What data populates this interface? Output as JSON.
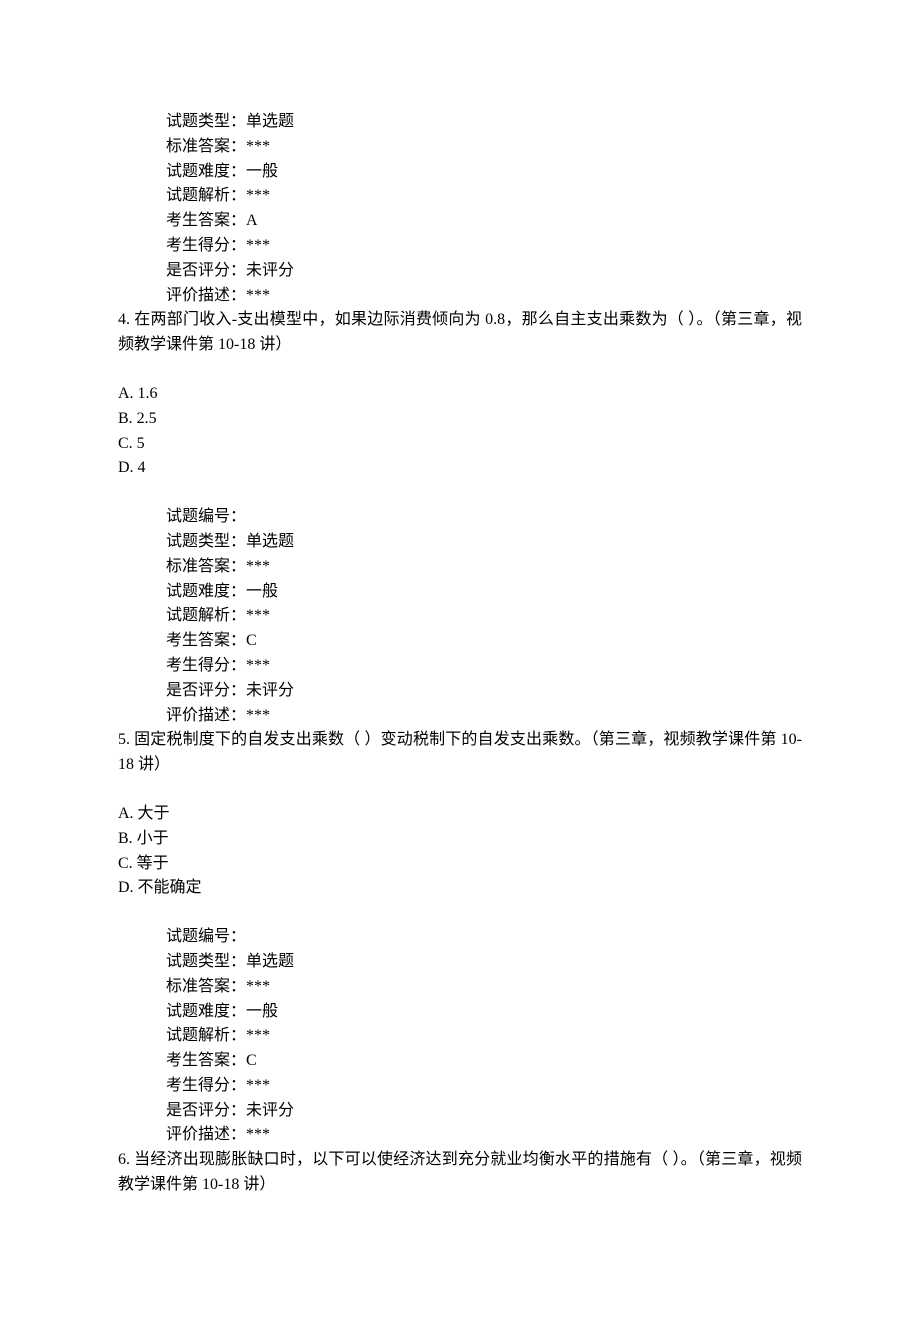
{
  "q3_meta": {
    "type_label": "试题类型：",
    "type_value": "单选题",
    "answer_key_label": "标准答案：",
    "answer_key_value": "***",
    "difficulty_label": "试题难度：",
    "difficulty_value": "一般",
    "analysis_label": "试题解析：",
    "analysis_value": "***",
    "student_answer_label": "考生答案：",
    "student_answer_value": "A",
    "student_score_label": "考生得分：",
    "student_score_value": "***",
    "graded_label": "是否评分：",
    "graded_value": "未评分",
    "desc_label": "评价描述：",
    "desc_value": "***"
  },
  "q4": {
    "number": "4.",
    "text": "    在两部门收入-支出模型中，如果边际消费倾向为 0.8，那么自主支出乘数为（  ）。（第三章，视频教学课件第 10-18 讲）",
    "options": {
      "a": "A. 1.6",
      "b": "B. 2.5",
      "c": "C. 5",
      "d": "D. 4"
    },
    "meta": {
      "id_label": "试题编号：",
      "id_value": "",
      "type_label": "试题类型：",
      "type_value": "单选题",
      "answer_key_label": "标准答案：",
      "answer_key_value": "***",
      "difficulty_label": "试题难度：",
      "difficulty_value": "一般",
      "analysis_label": "试题解析：",
      "analysis_value": "***",
      "student_answer_label": "考生答案：",
      "student_answer_value": "C",
      "student_score_label": "考生得分：",
      "student_score_value": "***",
      "graded_label": "是否评分：",
      "graded_value": "未评分",
      "desc_label": "评价描述：",
      "desc_value": "***"
    }
  },
  "q5": {
    "number": "5.",
    "text": "    固定税制度下的自发支出乘数（  ）变动税制下的自发支出乘数。（第三章，视频教学课件第 10-18 讲）",
    "options": {
      "a": "A. 大于",
      "b": "B. 小于",
      "c": "C. 等于",
      "d": "D. 不能确定"
    },
    "meta": {
      "id_label": "试题编号：",
      "id_value": "",
      "type_label": "试题类型：",
      "type_value": "单选题",
      "answer_key_label": "标准答案：",
      "answer_key_value": "***",
      "difficulty_label": "试题难度：",
      "difficulty_value": "一般",
      "analysis_label": "试题解析：",
      "analysis_value": "***",
      "student_answer_label": "考生答案：",
      "student_answer_value": "C",
      "student_score_label": "考生得分：",
      "student_score_value": "***",
      "graded_label": "是否评分：",
      "graded_value": "未评分",
      "desc_label": "评价描述：",
      "desc_value": "***"
    }
  },
  "q6": {
    "number": "6.",
    "text": "    当经济出现膨胀缺口时，以下可以使经济达到充分就业均衡水平的措施有（  ）。（第三章，视频教学课件第 10-18 讲）"
  }
}
